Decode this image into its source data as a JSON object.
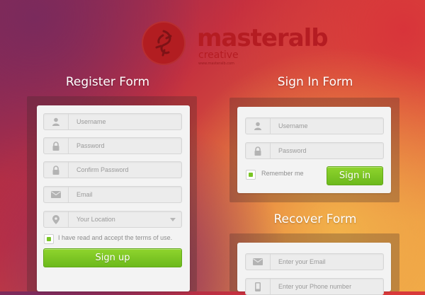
{
  "brand": {
    "name": "masteralb",
    "sub": "creative",
    "tiny": "www.masteralb.com",
    "color": "#b51c22"
  },
  "register": {
    "title": "Register Form",
    "username": "Username",
    "password": "Password",
    "confirm": "Confirm Password",
    "email": "Email",
    "location": "Your Location",
    "terms": "I have read and accept the terms of use.",
    "terms_checked": true,
    "submit": "Sign up"
  },
  "signin": {
    "title": "Sign In Form",
    "username": "Username",
    "password": "Password",
    "remember": "Remember me",
    "remember_checked": true,
    "submit": "Sign in"
  },
  "recover": {
    "title": "Recover Form",
    "email": "Enter your Email",
    "phone": "Enter your Phone number"
  },
  "colors": {
    "accent": "#79c524",
    "brand": "#b51c22"
  },
  "icons": {
    "user": "user-icon",
    "lock": "lock-icon",
    "mail": "mail-icon",
    "pin": "location-pin-icon",
    "phone": "phone-icon"
  }
}
